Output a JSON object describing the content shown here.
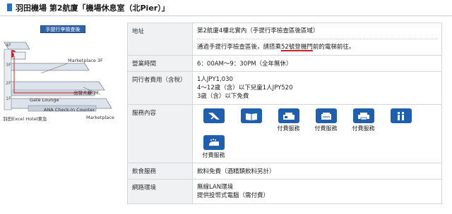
{
  "header": {
    "title": "羽田機場 第2航廈「機場休息室（北Pier）」"
  },
  "map": {
    "tag": "手提行李檢查後",
    "floors": [
      "4F",
      "3F",
      "2F",
      "1F"
    ],
    "labels": {
      "marketplace_3f": "Marketplace  3F",
      "gate_lounge": "Gate Lounge",
      "departure_2f": "出發大廳  2F",
      "checkin": "ANA Check-in Counter",
      "hotel": "羽田Excel Hotel東急",
      "marketplace": "Marketplace"
    },
    "accent_color": "#d0202a",
    "floor_color": "#dde3ea"
  },
  "table": {
    "address": {
      "label": "地址",
      "line1": "第2航廈4樓北實內（手提行李檢查區後區域）",
      "line2_pre": "通過手提行李檢查區後，請搭乘",
      "line2_hl": "52號登機門",
      "line2_post": "前的電梯前往。"
    },
    "hours": {
      "label": "營業時間",
      "value": "6：00AM～9：30PM（全年無休）"
    },
    "fee": {
      "label": "同行者費用（含稅）",
      "lines": [
        "1人JPY1,030",
        "4～12歲（含）以下兒童1人JPY520",
        "3歲（含）以下免費"
      ]
    },
    "services": {
      "label": "服務內容",
      "items": [
        {
          "icon": "airplane-icon",
          "label": ""
        },
        {
          "icon": "newspaper-icon",
          "label": ""
        },
        {
          "icon": "fax-icon",
          "label": "付費服務"
        },
        {
          "icon": "copier-icon",
          "label": "付費服務"
        },
        {
          "icon": "printer-icon",
          "label": "付費服務"
        },
        {
          "icon": "info-icon",
          "label": ""
        },
        {
          "icon": "shower-icon",
          "label": "付費服務"
        }
      ]
    },
    "drinks": {
      "label": "飲食服務",
      "value": "飲料免費（酒精類飲料另計）"
    },
    "network": {
      "label": "網路環境",
      "lines": [
        "無線LAN環境",
        "提供投幣式電腦（需付費）"
      ]
    }
  },
  "colors": {
    "brand_blue": "#1f5fae",
    "underline_red": "#d0202a"
  }
}
